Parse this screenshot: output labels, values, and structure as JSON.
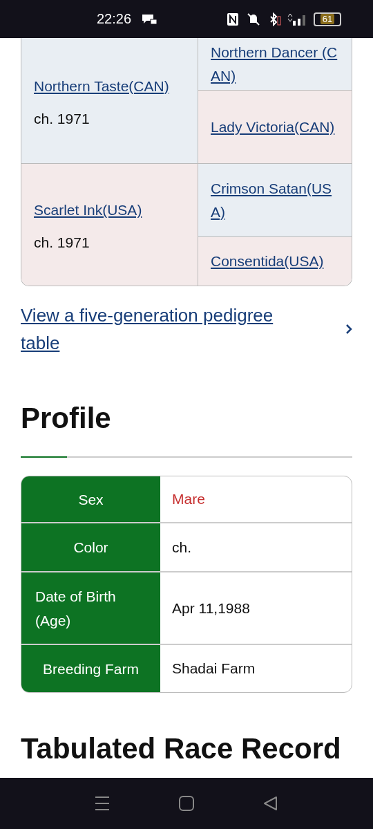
{
  "status_bar": {
    "time": "22:26",
    "battery": "61"
  },
  "pedigree": {
    "rows": [
      {
        "kind": "sire",
        "name": "Northern Taste(CAN)",
        "detail": "ch. 1971",
        "parents": [
          {
            "kind": "sire",
            "name": "Northern Dancer (CAN)"
          },
          {
            "kind": "dam",
            "name": "Lady Victoria(CAN)"
          }
        ]
      },
      {
        "kind": "dam",
        "name": "Scarlet Ink(USA)",
        "detail": "ch. 1971",
        "parents": [
          {
            "kind": "sire",
            "name": "Crimson Satan(USA)"
          },
          {
            "kind": "dam",
            "name": "Consentida(USA)"
          }
        ]
      }
    ]
  },
  "pedigree_link": "View a five-generation pedigree table",
  "profile": {
    "heading": "Profile",
    "rows": [
      {
        "label": "Sex",
        "value": "Mare",
        "color": "#c62e2e"
      },
      {
        "label": "Color",
        "value": "ch.",
        "color": "#111111"
      },
      {
        "label": "Date of Birth (Age)",
        "value": "Apr 11,1988",
        "color": "#111111"
      },
      {
        "label": "Breeding Farm",
        "value": "Shadai Farm",
        "color": "#111111"
      }
    ]
  },
  "next_heading": "Tabulated Race Record"
}
